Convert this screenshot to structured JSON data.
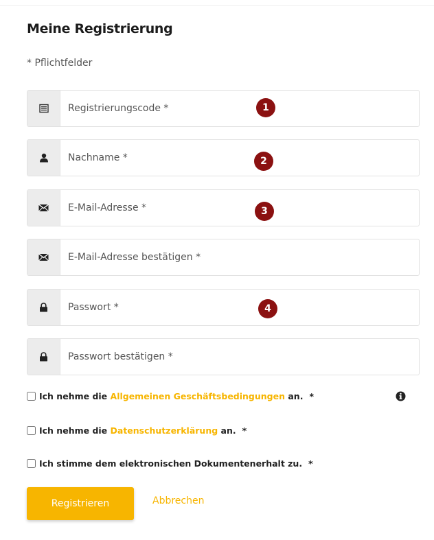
{
  "title": "Meine Registrierung",
  "required_note": "* Pflichtfelder",
  "fields": [
    {
      "icon": "list-icon",
      "placeholder": "Registrierungscode *",
      "badge": "1"
    },
    {
      "icon": "user-icon",
      "placeholder": "Nachname *",
      "badge": "2"
    },
    {
      "icon": "envelope-icon",
      "placeholder": "E-Mail-Adresse *",
      "badge": "3"
    },
    {
      "icon": "envelope-icon",
      "placeholder": "E-Mail-Adresse bestätigen *"
    },
    {
      "icon": "lock-icon",
      "placeholder": "Passwort *",
      "badge": "4"
    },
    {
      "icon": "lock-icon",
      "placeholder": "Passwort bestätigen *"
    }
  ],
  "checkboxes": {
    "agb": {
      "before": "Ich nehme die ",
      "link": "Allgemeinen Geschäftsbedingungen",
      "after": " an.",
      "star": "*"
    },
    "privacy": {
      "before": "Ich nehme die ",
      "link": "Datenschutzerklärung",
      "after": " an.",
      "star": "*"
    },
    "documents": {
      "text": "Ich stimme dem elektronischen Dokumentenerhalt zu.",
      "star": "*"
    }
  },
  "info_icon": "info-circle-icon",
  "buttons": {
    "register": "Registrieren",
    "cancel": "Abbrechen"
  },
  "colors": {
    "accent": "#f7b500",
    "badge": "#8b1111",
    "addon_bg": "#ececec"
  }
}
